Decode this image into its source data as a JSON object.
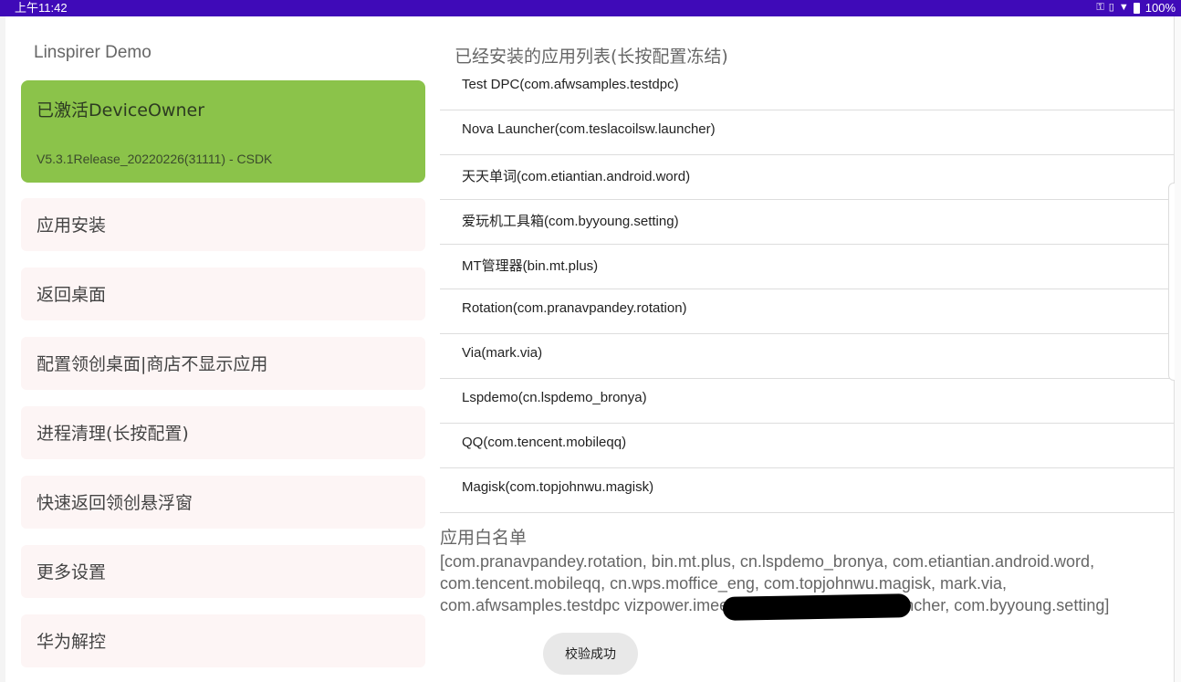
{
  "status_bar": {
    "time": "上午11:42",
    "battery": "100%",
    "icons": [
      "key-icon",
      "vibrate-icon",
      "wifi-icon",
      "battery-icon"
    ]
  },
  "app": {
    "title": "Linspirer Demo",
    "active_card": {
      "title": "已激活DeviceOwner",
      "version": "V5.3.1Release_20220226(31111) - CSDK",
      "color": "#8bc34a"
    },
    "menu": [
      {
        "label": "应用安装"
      },
      {
        "label": "返回桌面"
      },
      {
        "label": "配置领创桌面|商店不显示应用"
      },
      {
        "label": "进程清理(长按配置)"
      },
      {
        "label": "快速返回领创悬浮窗"
      },
      {
        "label": "更多设置"
      },
      {
        "label": "华为解控"
      }
    ],
    "installed_header": "已经安装的应用列表(长按配置冻结)",
    "installed_apps": [
      {
        "label": "Test DPC(com.afwsamples.testdpc)"
      },
      {
        "label": "Nova Launcher(com.teslacoilsw.launcher)"
      },
      {
        "label": "天天单词(com.etiantian.android.word)"
      },
      {
        "label": "爱玩机工具箱(com.byyoung.setting)"
      },
      {
        "label": "MT管理器(bin.mt.plus)"
      },
      {
        "label": "Rotation(com.pranavpandey.rotation)"
      },
      {
        "label": "Via(mark.via)"
      },
      {
        "label": "Lspdemo(cn.lspdemo_bronya)"
      },
      {
        "label": "QQ(com.tencent.mobileqq)"
      },
      {
        "label": "Magisk(com.topjohnwu.magisk)"
      }
    ],
    "whitelist_header": "应用白名单",
    "whitelist_text": "[com.pranavpandey.rotation, bin.mt.plus, cn.lspdemo_bronya, com.etiantian.android.word, com.tencent.mobileqq, cn.wps.moffice_eng, com.topjohnwu.magisk, mark.via, com.afwsamples.testdpc                                      vizpower.imeeting, com.teslacoilsw.launcher, com.byyoung.setting]",
    "toast": "校验成功"
  },
  "colors": {
    "status_bar": "#3f0ab8",
    "menu_bg": "#fdf5f5"
  }
}
